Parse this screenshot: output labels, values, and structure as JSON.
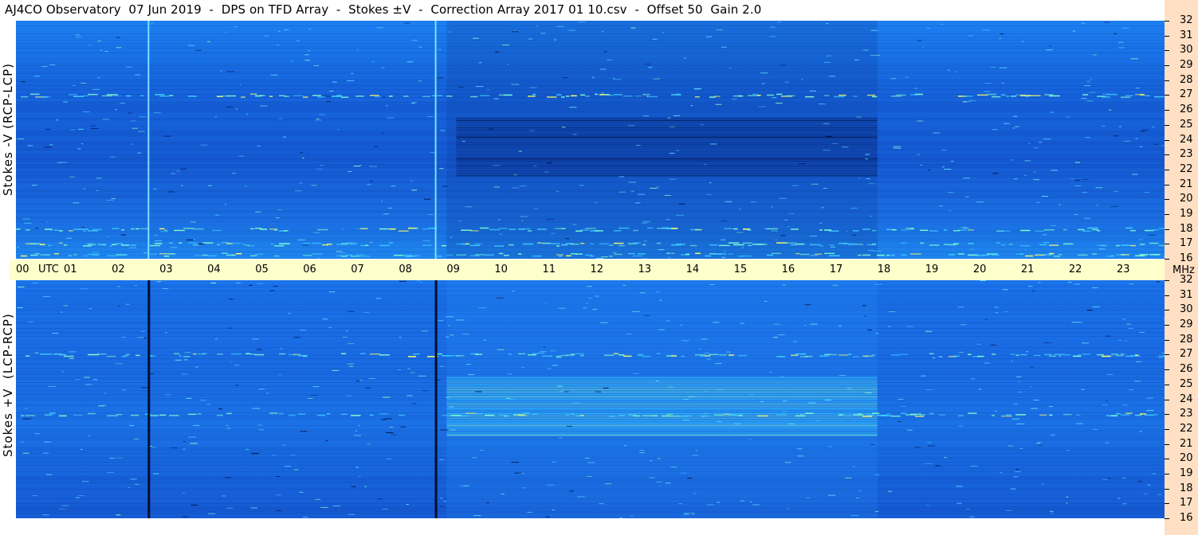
{
  "title": "AJ4CO Observatory  07 Jun 2019  -  DPS on TFD Array  -  Stokes ±V  -  Correction Array 2017 01 10.csv  -  Offset 50  Gain 2.0",
  "chart_data": [
    {
      "type": "heatmap",
      "panel": "top",
      "ylabel": "Stokes -V (RCP-LCP)",
      "x_axis": {
        "label": "UTC",
        "ticks": [
          "00",
          "01",
          "02",
          "03",
          "04",
          "05",
          "06",
          "07",
          "08",
          "09",
          "10",
          "11",
          "12",
          "13",
          "14",
          "15",
          "16",
          "17",
          "18",
          "19",
          "20",
          "21",
          "22",
          "23",
          "00"
        ],
        "range_hours": [
          0,
          24
        ]
      },
      "y_axis": {
        "unit": "MHz",
        "range": [
          16,
          32
        ],
        "ticks": [
          "16",
          "17",
          "18",
          "19",
          "20",
          "21",
          "22",
          "23",
          "24",
          "25",
          "26",
          "27",
          "28",
          "29",
          "30",
          "31",
          "32"
        ]
      },
      "colormap": [
        "#000033",
        "#0a3aa0",
        "#1a6fe0",
        "#2fa6ff",
        "#7fffd0",
        "#ffff66",
        "#ff6060"
      ],
      "features": {
        "vertical_lines_utc": [
          2.77,
          8.77
        ],
        "vertical_line_color": "#7fe8ff",
        "bright_bands_mhz": [
          16.3,
          17.0,
          18.0,
          27.0
        ],
        "dark_region": {
          "utc": [
            9.0,
            18.0
          ],
          "mhz": [
            21.5,
            25.5
          ]
        }
      }
    },
    {
      "type": "heatmap",
      "panel": "bottom",
      "ylabel": "Stokes +V  (LCP-RCP)",
      "x_axis": {
        "range_hours": [
          0,
          24
        ]
      },
      "y_axis": {
        "unit": "MHz",
        "range": [
          16,
          32
        ],
        "ticks": [
          "16",
          "17",
          "18",
          "19",
          "20",
          "21",
          "22",
          "23",
          "24",
          "25",
          "26",
          "27",
          "28",
          "29",
          "30",
          "31",
          "32"
        ]
      },
      "features": {
        "vertical_lines_utc": [
          2.77,
          8.77
        ],
        "vertical_line_color": "#000820",
        "bright_bands_mhz": [
          27.0,
          23.0
        ],
        "bright_region": {
          "utc": [
            9.0,
            18.0
          ],
          "mhz": [
            21.5,
            25.5
          ]
        }
      }
    }
  ],
  "timebar": {
    "utc_label": "UTC",
    "mhz_label": "MHz"
  }
}
